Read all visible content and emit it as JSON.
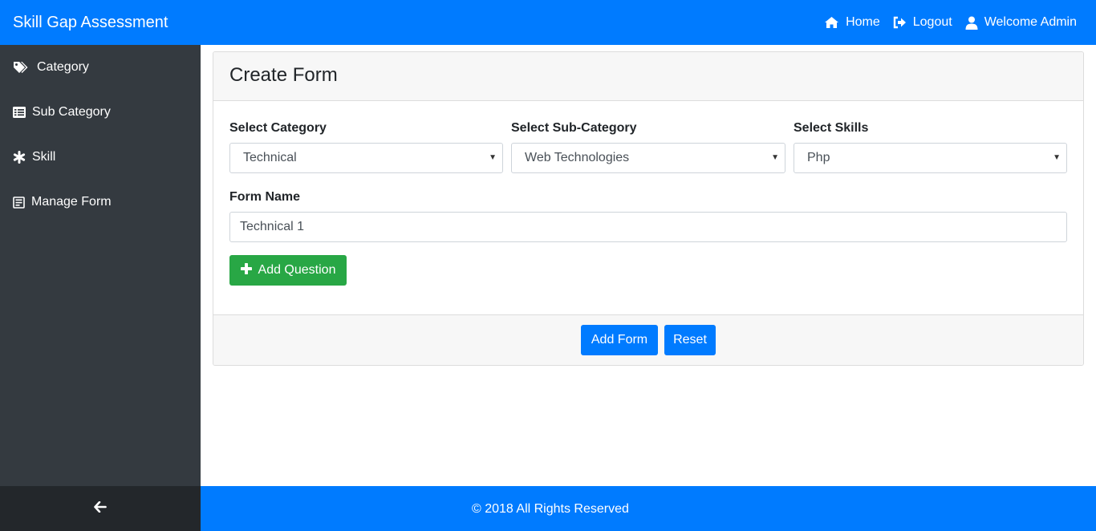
{
  "header": {
    "brand": "Skill Gap Assessment",
    "nav": [
      {
        "label": "Home",
        "icon": "home-icon"
      },
      {
        "label": "Logout",
        "icon": "logout-icon"
      },
      {
        "label": "Welcome Admin",
        "icon": "user-icon"
      }
    ]
  },
  "sidebar": {
    "items": [
      {
        "label": "Category",
        "icon": "tags-icon"
      },
      {
        "label": "Sub Category",
        "icon": "list-icon"
      },
      {
        "label": "Skill",
        "icon": "asterisk-icon"
      },
      {
        "label": "Manage Form",
        "icon": "form-icon"
      }
    ],
    "collapse_icon": "arrow-left-icon"
  },
  "form": {
    "title": "Create Form",
    "category_label": "Select Category",
    "category_value": "Technical",
    "subcategory_label": "Select Sub-Category",
    "subcategory_value": "Web Technologies",
    "skills_label": "Select Skills",
    "skills_value": "Php",
    "form_name_label": "Form Name",
    "form_name_value": "Technical 1",
    "add_question_label": "Add Question",
    "add_form_label": "Add Form",
    "reset_label": "Reset"
  },
  "footer": {
    "text": "© 2018 All Rights Reserved"
  },
  "colors": {
    "primary": "#007bff",
    "success": "#28a745",
    "sidebar": "#343a40",
    "sidebar_footer": "#23272b"
  }
}
